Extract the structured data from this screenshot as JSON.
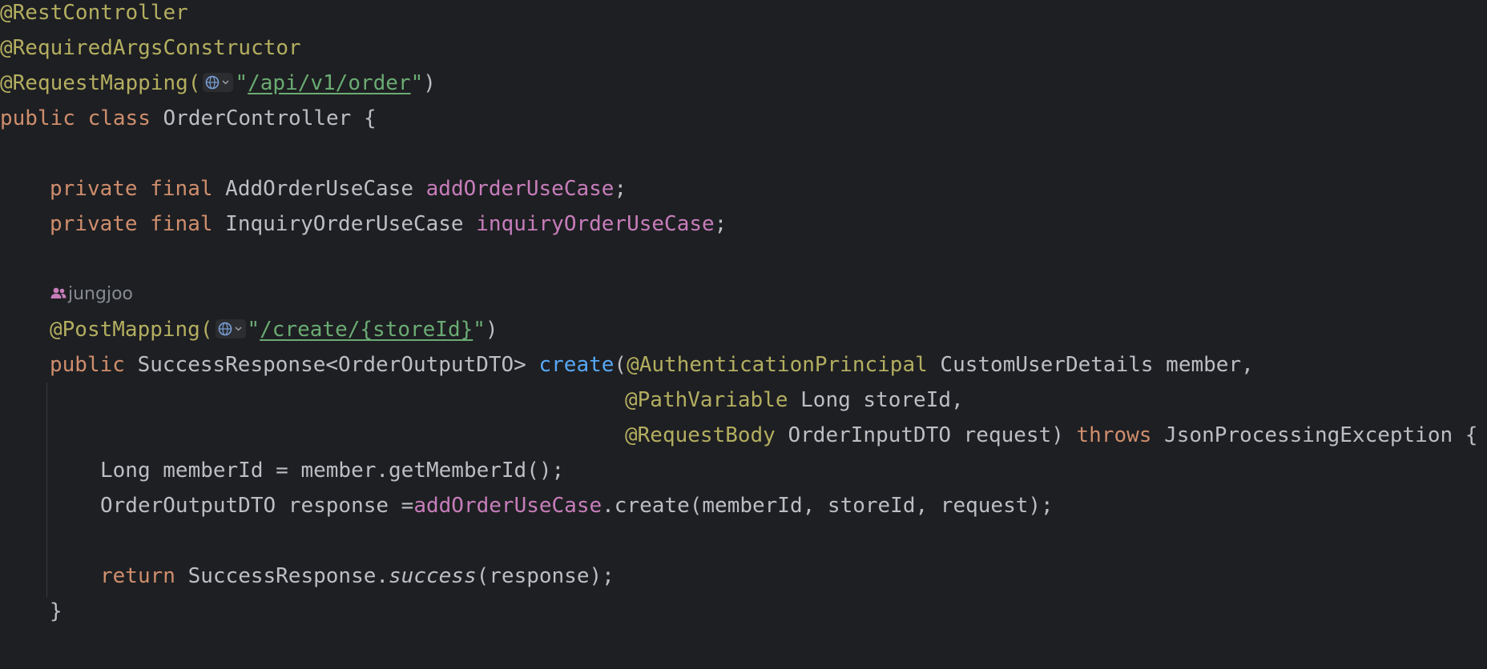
{
  "code": {
    "l1": {
      "annotation": "@RestController"
    },
    "l2": {
      "annotation": "@RequiredArgsConstructor"
    },
    "l3": {
      "annotation": "@RequestMapping(",
      "quote_open": "\"",
      "path": "/api/v1/order",
      "close": "\")"
    },
    "l4": {
      "kw_public": "public",
      "kw_class": "class",
      "class_name": "OrderController {"
    },
    "l6": {
      "kw_private": "private",
      "kw_final": "final",
      "type": "AddOrderUseCase",
      "field": "addOrderUseCase",
      "semi": ";"
    },
    "l7": {
      "kw_private": "private",
      "kw_final": "final",
      "type": "InquiryOrderUseCase",
      "field": "inquiryOrderUseCase",
      "semi": ";"
    },
    "author": {
      "name": "jungjoo"
    },
    "l9": {
      "annotation": "@PostMapping(",
      "quote_open": "\"",
      "path": "/create/{storeId}",
      "close": "\")"
    },
    "l10": {
      "kw_public": "public",
      "return_type": "SuccessResponse<OrderOutputDTO>",
      "method": "create",
      "paren": "(",
      "annotation": "@AuthenticationPrincipal",
      "param": "CustomUserDetails member,"
    },
    "l11": {
      "annotation": "@PathVariable",
      "param": "Long storeId,"
    },
    "l12": {
      "annotation": "@RequestBody",
      "param": "OrderInputDTO request)",
      "kw_throws": "throws",
      "exception": "JsonProcessingException {"
    },
    "l13": {
      "text": "Long memberId = member.getMemberId();"
    },
    "l14": {
      "prefix": "OrderOutputDTO response =",
      "field": "addOrderUseCase",
      "rest": ".create(memberId, storeId, request);"
    },
    "l16": {
      "kw_return": "return",
      "cls": "SuccessResponse.",
      "method": "success",
      "args": "(response);"
    },
    "l17": {
      "brace": "}"
    }
  },
  "icons": {
    "inlay": "globe-icon",
    "author": "people-icon"
  },
  "colors": {
    "background": "#1e1f22",
    "default_text": "#bcbec4",
    "annotation": "#b3ae60",
    "keyword": "#cf8e6d",
    "field": "#c77dbb",
    "method": "#56a8f5",
    "string": "#6aab73",
    "author": "#868a91"
  }
}
